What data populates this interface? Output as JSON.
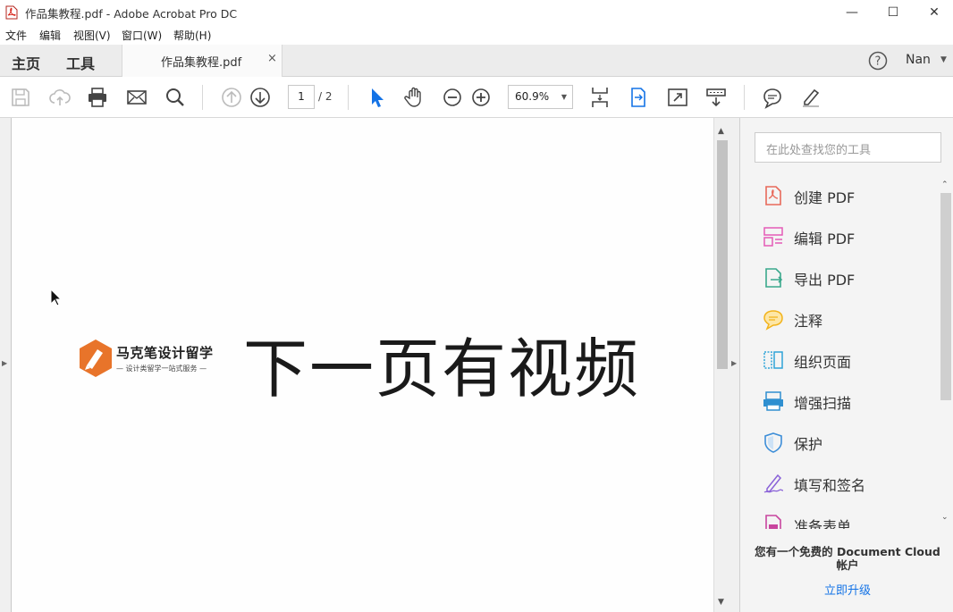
{
  "window": {
    "title": "作品集教程.pdf - Adobe Acrobat Pro DC",
    "minimize": "—",
    "maximize": "☐",
    "close": "✕"
  },
  "menu": [
    "文件",
    "编辑",
    "视图(V)",
    "窗口(W)",
    "帮助(H)"
  ],
  "tabs": {
    "home": "主页",
    "tools": "工具",
    "document": "作品集教程.pdf",
    "close": "×"
  },
  "account": {
    "help": "?",
    "user": "Nan"
  },
  "toolbar": {
    "page_current": "1",
    "page_total": "/ 2",
    "zoom": "60.9%"
  },
  "document": {
    "logo_brand": "马克笔设计留学",
    "logo_tagline": "— 设计类留学一站式服务 —",
    "headline": "下一页有视频"
  },
  "panel": {
    "search_placeholder": "在此处查找您的工具",
    "tools": [
      {
        "label": "创建 PDF",
        "icon": "create-pdf-icon",
        "color": "#e8695a"
      },
      {
        "label": "编辑 PDF",
        "icon": "edit-pdf-icon",
        "color": "#e45bb6"
      },
      {
        "label": "导出 PDF",
        "icon": "export-pdf-icon",
        "color": "#3aa88c"
      },
      {
        "label": "注释",
        "icon": "comment-icon",
        "color": "#f2b31b"
      },
      {
        "label": "组织页面",
        "icon": "organize-pages-icon",
        "color": "#2fa3d8"
      },
      {
        "label": "增强扫描",
        "icon": "enhance-scan-icon",
        "color": "#2f8fd0"
      },
      {
        "label": "保护",
        "icon": "protect-icon",
        "color": "#3d8ed8"
      },
      {
        "label": "填写和签名",
        "icon": "fill-sign-icon",
        "color": "#8a62d8"
      },
      {
        "label": "准备表单",
        "icon": "prepare-form-icon",
        "color": "#c8459e"
      }
    ],
    "cloud_message": "您有一个免费的 Document Cloud 帐户",
    "upgrade": "立即升级"
  },
  "colors": {
    "accent": "#1473e6",
    "logo_orange": "#e8742a"
  }
}
